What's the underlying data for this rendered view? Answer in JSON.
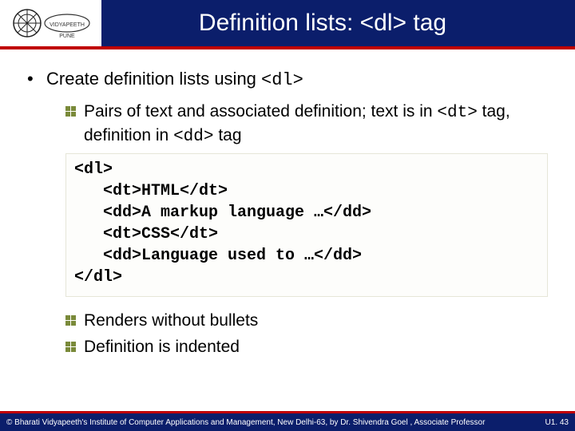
{
  "header": {
    "title": "Definition lists: <dl> tag"
  },
  "main": {
    "bullet": "Create definition lists using ",
    "bullet_code": "<dl>",
    "sub1_pre": "Pairs of text and associated definition; text is in ",
    "sub1_code1": "<dt>",
    "sub1_mid": " tag, definition in ",
    "sub1_code2": "<dd>",
    "sub1_post": " tag",
    "code_lines": [
      "<dl>",
      "   <dt>HTML</dt>",
      "   <dd>A markup language …</dd>",
      "   <dt>CSS</dt>",
      "   <dd>Language used to …</dd>",
      "</dl>"
    ],
    "sub2": "Renders without bullets",
    "sub3": "Definition is indented"
  },
  "footer": {
    "copyright": "© Bharati Vidyapeeth's Institute of Computer Applications and Management, New Delhi-63, by Dr. Shivendra Goel , Associate Professor",
    "slide": "U1. 43"
  }
}
